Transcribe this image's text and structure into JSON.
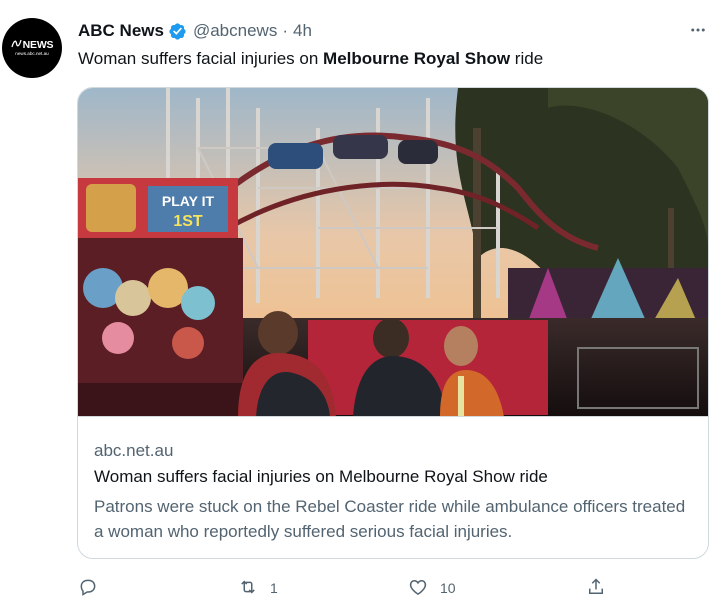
{
  "author": {
    "avatar_brand": "NEWS",
    "avatar_url_text": "news.abc.net.au",
    "name": "ABC News",
    "handle": "@abcnews",
    "separator": "·",
    "time": "4h",
    "verified_color": "#1d9bf0"
  },
  "tweet": {
    "text_before": "Woman suffers facial injuries on ",
    "text_bold": "Melbourne Royal Show",
    "text_after": " ride"
  },
  "card": {
    "domain": "abc.net.au",
    "title": "Woman suffers facial injuries on Melbourne Royal Show ride",
    "description": "Patrons were stuck on the Rebel Coaster ride while ambulance officers treated a woman who reportedly suffered serious facial injuries.",
    "sign_text_1": "PLAY IT",
    "sign_text_2": "1ST"
  },
  "actions": {
    "reply_count": "",
    "retweet_count": "1",
    "like_count": "10",
    "share_count": ""
  },
  "icons": {
    "more": "more-options-icon",
    "reply": "reply-icon",
    "retweet": "retweet-icon",
    "like": "heart-icon",
    "share": "share-icon",
    "verified": "verified-badge-icon"
  },
  "colors": {
    "text_primary": "#0f1419",
    "text_secondary": "#536471",
    "border": "#cfd9de",
    "brand_blue": "#1d9bf0"
  }
}
